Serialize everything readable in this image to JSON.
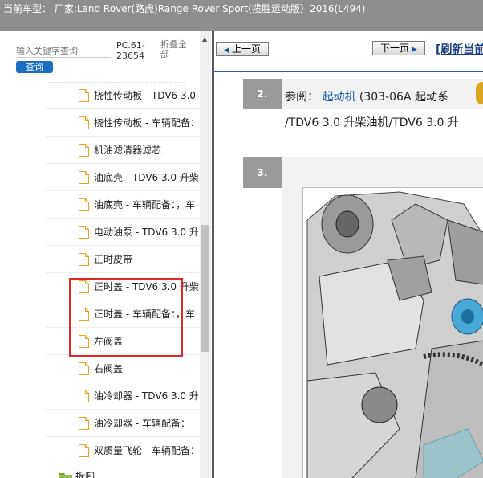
{
  "title_bar": {
    "text": "当前车型： 厂家:Land Rover(路虎)Range Rover Sport(揽胜运动版）2016(L494)"
  },
  "sidebar": {
    "search_placeholder": "输入关键字查询",
    "query_label": "查询",
    "doc_code": "PC.61-23654",
    "collapse_all": "折叠全部",
    "items": [
      {
        "label": "挠性传动板 - TDV6 3.0"
      },
      {
        "label": "挠性传动板 - 车辆配备："
      },
      {
        "label": "机油滤清器滤芯"
      },
      {
        "label": "油底壳 - TDV6 3.0 升柴"
      },
      {
        "label": "油底壳 - 车辆配备：，车"
      },
      {
        "label": "电动油泵 - TDV6 3.0 升"
      },
      {
        "label": "正时皮带"
      },
      {
        "label": "正时盖 - TDV6 3.0 升柴"
      },
      {
        "label": "正时盖 - 车辆配备：，车"
      },
      {
        "label": "左阀盖"
      },
      {
        "label": "右阀盖"
      },
      {
        "label": "油冷却器 - TDV6 3.0 升"
      },
      {
        "label": "油冷却器 - 车辆配备："
      },
      {
        "label": "双质量飞轮 - 车辆配备："
      }
    ],
    "folder": {
      "label": "拆卸"
    }
  },
  "toolbar": {
    "prev_label": "上一页",
    "next_label": "下一页",
    "refresh_label": "[刷新当前"
  },
  "steps": [
    {
      "number": "2.",
      "prefix": "参阅：",
      "link": "起动机",
      "rest": " (303-06A 起动系",
      "line2": "/TDV6 3.0 升柴油机/TDV6 3.0 升"
    },
    {
      "number": "3."
    }
  ],
  "colors": {
    "title_bar_bg": "#8e8e8e",
    "query_button": "#1a6fc4",
    "highlight": "#e02a2a",
    "link": "#1a5fb4",
    "folder": "#8bc34a",
    "doc_icon": "#f0a020"
  }
}
